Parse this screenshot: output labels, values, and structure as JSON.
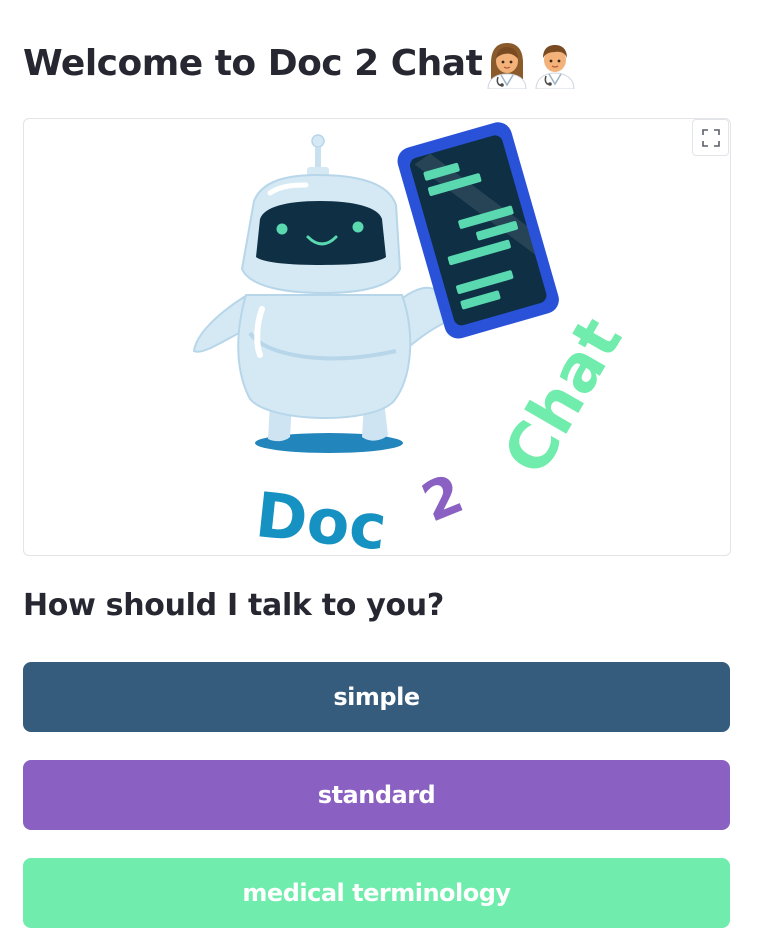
{
  "page": {
    "title": "Welcome to Doc 2 Chat",
    "title_icons": [
      "female-doctor-icon",
      "male-doctor-icon"
    ]
  },
  "logo": {
    "word_doc": "Doc",
    "word_two": "2",
    "word_chat": "Chat",
    "colors": {
      "doc": "#1591c2",
      "two": "#8a61c2",
      "chat": "#70ecac",
      "robot_body": "#d5e9f4",
      "phone_frame": "#2a52d8",
      "phone_screen": "#0f2f44"
    }
  },
  "image_toolbar": {
    "fullscreen_icon": "fullscreen-icon"
  },
  "tone": {
    "heading": "How should I talk to you?",
    "options": [
      {
        "label": "simple",
        "color": "#365c7d"
      },
      {
        "label": "standard",
        "color": "#8a61c2"
      },
      {
        "label": "medical terminology",
        "color": "#70ecac"
      }
    ]
  }
}
